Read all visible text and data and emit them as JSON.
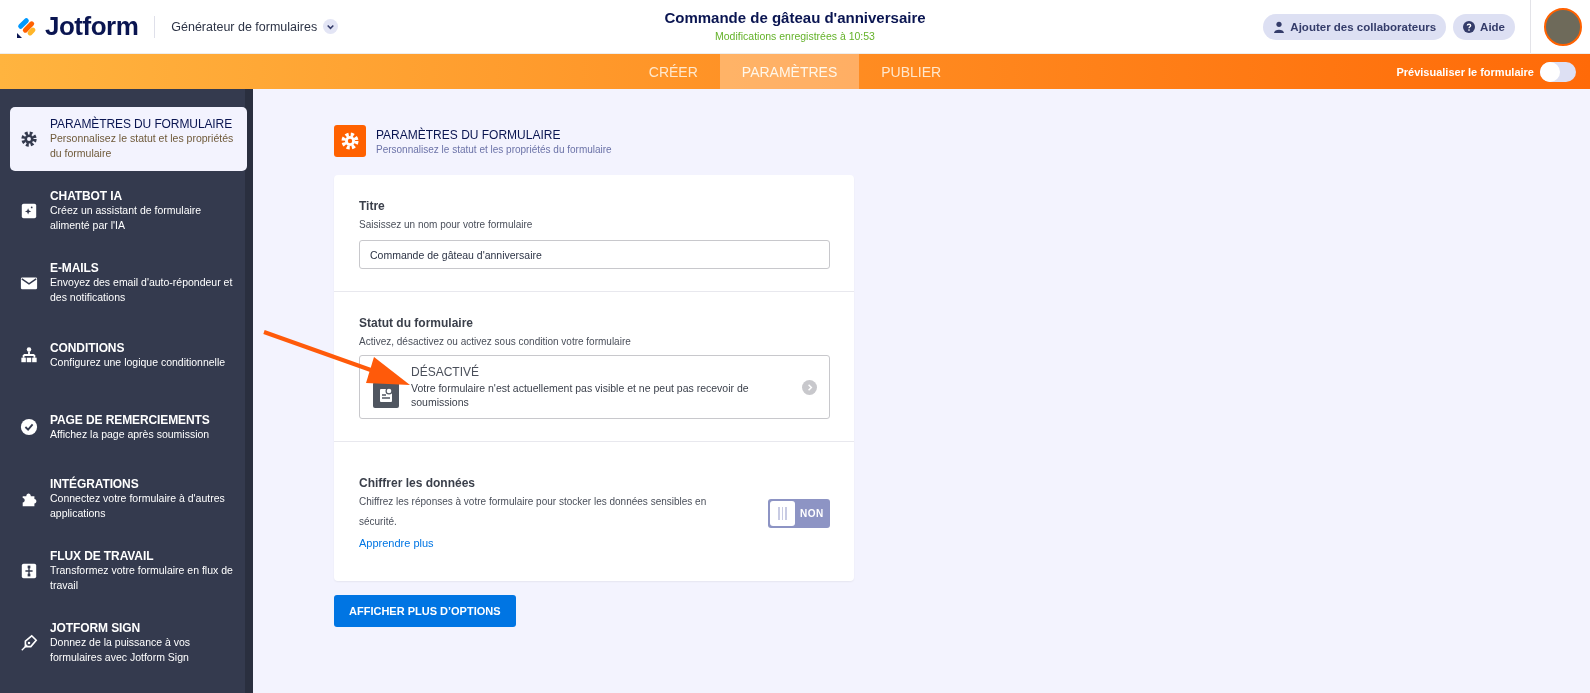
{
  "header": {
    "brand": "Jotform",
    "product": "Générateur de formulaires",
    "form_title": "Commande de gâteau d'anniversaire",
    "save_status": "Modifications enregistrées à 10:53",
    "buttons": [
      {
        "label": "Ajouter des collaborateurs"
      },
      {
        "label": "Aide"
      }
    ]
  },
  "tabs": [
    {
      "label": "CRÉER",
      "selected": false
    },
    {
      "label": "PARAMÈTRES",
      "selected": true
    },
    {
      "label": "PUBLIER",
      "selected": false
    }
  ],
  "preview": {
    "label": "Prévisualiser le formulaire",
    "on": false
  },
  "sidebar": {
    "items": [
      {
        "title": "PARAMÈTRES DU FORMULAIRE",
        "description": "Personnalisez le statut et les propriétés du formulaire",
        "selected": true
      },
      {
        "title": "CHATBOT IA",
        "description": "Créez un assistant de formulaire alimenté par l'IA",
        "selected": false
      },
      {
        "title": "E-MAILS",
        "description": "Envoyez des email d'auto-répondeur et des notifications",
        "selected": false
      },
      {
        "title": "CONDITIONS",
        "description": "Configurez une logique conditionnelle",
        "selected": false
      },
      {
        "title": "PAGE DE REMERCIEMENTS",
        "description": "Affichez la page après soumission",
        "selected": false
      },
      {
        "title": "INTÉGRATIONS",
        "description": "Connectez votre formulaire à d'autres applications",
        "selected": false
      },
      {
        "title": "FLUX DE TRAVAIL",
        "description": "Transformez votre formulaire en flux de travail",
        "selected": false
      },
      {
        "title": "JOTFORM SIGN",
        "description": "Donnez de la puissance à vos formulaires avec Jotform Sign",
        "selected": false
      }
    ]
  },
  "page": {
    "title": "PARAMÈTRES DU FORMULAIRE",
    "subtitle": "Personnalisez le statut et les propriétés du formulaire"
  },
  "sections": [
    {
      "kind": "text",
      "label": "Titre",
      "description": "Saisissez un nom pour votre formulaire",
      "value": "Commande de gâteau d'anniversaire"
    },
    {
      "kind": "status",
      "label": "Statut du formulaire",
      "description": "Activez, désactivez ou activez sous condition votre formulaire",
      "status_title": "DÉSACTIVÉ",
      "status_text": "Votre formulaire n'est actuellement pas visible et ne peut pas recevoir de soumissions"
    },
    {
      "kind": "toggle",
      "label": "Chiffrer les données",
      "description": "Chiffrez les réponses à votre formulaire pour stocker les données sensibles en sécurité.",
      "link": "Apprendre plus",
      "on": false,
      "toggle_text": "NON"
    }
  ],
  "more_button": "AFFICHER PLUS D’OPTIONS"
}
